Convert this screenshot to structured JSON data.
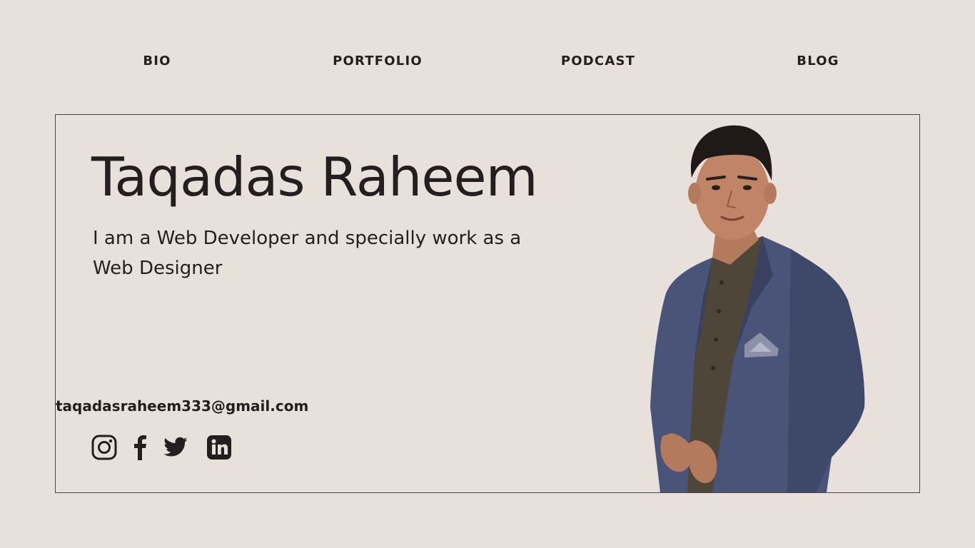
{
  "nav": {
    "items": [
      {
        "label": "BIO"
      },
      {
        "label": "PORTFOLIO"
      },
      {
        "label": "PODCAST"
      },
      {
        "label": "BLOG"
      }
    ]
  },
  "hero": {
    "name": "Taqadas Raheem",
    "tagline": "I am a Web Developer and specially work as a Web Designer",
    "email": "taqadasraheem333@gmail.com"
  },
  "social": [
    {
      "icon": "instagram-icon"
    },
    {
      "icon": "facebook-icon"
    },
    {
      "icon": "twitter-icon"
    },
    {
      "icon": "linkedin-icon"
    }
  ],
  "colors": {
    "background": "#e8e0db",
    "text": "#231f20",
    "jacket": "#4a5478",
    "shirt": "#4e4638"
  }
}
